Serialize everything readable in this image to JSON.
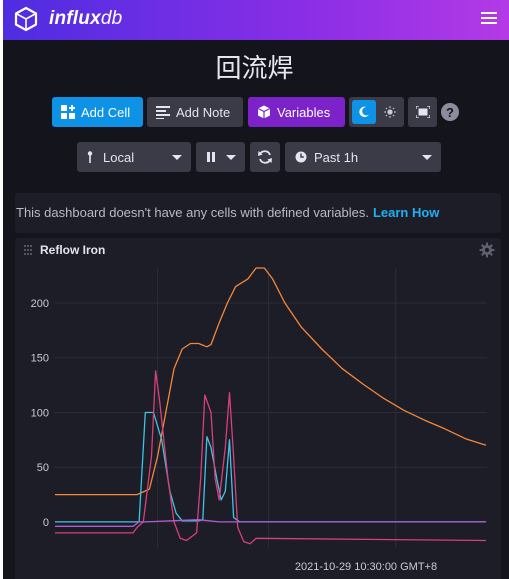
{
  "app": {
    "logo_text_bold": "influx",
    "logo_text_light": "db"
  },
  "dashboard": {
    "title": "回流焊"
  },
  "toolbar": {
    "add_cell_label": "Add Cell",
    "add_note_label": "Add Note",
    "variables_label": "Variables",
    "help_label": "?"
  },
  "controls": {
    "timezone": "Local",
    "time_range": "Past 1h"
  },
  "notice": {
    "text": "This dashboard doesn't have any cells with defined variables.",
    "link_label": "Learn How"
  },
  "cell": {
    "title": "Reflow Iron"
  },
  "colors": {
    "accent": "#0d92e6",
    "variables": "#7b22c8",
    "link": "#1fb0f2"
  },
  "chart_data": {
    "type": "line",
    "y_ticks": [
      "200",
      "150",
      "100",
      "50",
      "0"
    ],
    "y_tick_values": [
      200,
      150,
      100,
      50,
      0
    ],
    "ylim": [
      -22,
      232
    ],
    "x_tick_label": "2021-10-29 10:30:00 GMT+8",
    "grid": true,
    "legend": "none",
    "series": [
      {
        "color": "#f5873a",
        "points": [
          [
            0,
            25
          ],
          [
            0.2,
            25
          ],
          [
            0.23,
            30
          ],
          [
            0.25,
            60
          ],
          [
            0.27,
            100
          ],
          [
            0.29,
            140
          ],
          [
            0.31,
            158
          ],
          [
            0.33,
            163
          ],
          [
            0.35,
            163
          ],
          [
            0.37,
            160
          ],
          [
            0.38,
            162
          ],
          [
            0.4,
            182
          ],
          [
            0.42,
            200
          ],
          [
            0.44,
            215
          ],
          [
            0.47,
            222
          ],
          [
            0.49,
            232
          ],
          [
            0.51,
            232
          ],
          [
            0.53,
            222
          ],
          [
            0.56,
            200
          ],
          [
            0.6,
            178
          ],
          [
            0.65,
            158
          ],
          [
            0.7,
            140
          ],
          [
            0.75,
            126
          ],
          [
            0.8,
            113
          ],
          [
            0.85,
            102
          ],
          [
            0.9,
            93
          ],
          [
            0.95,
            85
          ],
          [
            1.0,
            76
          ],
          [
            1.05,
            70
          ]
        ]
      },
      {
        "color": "#3fc3e6",
        "points": [
          [
            0,
            0
          ],
          [
            0.19,
            0
          ],
          [
            0.205,
            0
          ],
          [
            0.22,
            100
          ],
          [
            0.24,
            100
          ],
          [
            0.26,
            75
          ],
          [
            0.28,
            28
          ],
          [
            0.295,
            8
          ],
          [
            0.31,
            1
          ],
          [
            0.35,
            1
          ],
          [
            0.36,
            2
          ],
          [
            0.37,
            78
          ],
          [
            0.38,
            68
          ],
          [
            0.395,
            38
          ],
          [
            0.405,
            20
          ],
          [
            0.415,
            28
          ],
          [
            0.425,
            75
          ],
          [
            0.435,
            4
          ],
          [
            0.45,
            0
          ],
          [
            1.05,
            0
          ]
        ]
      },
      {
        "color": "#d7417a",
        "points": [
          [
            0,
            -10
          ],
          [
            0.19,
            -10
          ],
          [
            0.2,
            -5
          ],
          [
            0.215,
            0
          ],
          [
            0.235,
            60
          ],
          [
            0.245,
            138
          ],
          [
            0.255,
            110
          ],
          [
            0.275,
            40
          ],
          [
            0.29,
            0
          ],
          [
            0.305,
            -15
          ],
          [
            0.32,
            -17
          ],
          [
            0.345,
            -10
          ],
          [
            0.355,
            40
          ],
          [
            0.365,
            116
          ],
          [
            0.38,
            100
          ],
          [
            0.39,
            40
          ],
          [
            0.4,
            20
          ],
          [
            0.415,
            68
          ],
          [
            0.425,
            118
          ],
          [
            0.435,
            60
          ],
          [
            0.445,
            -5
          ],
          [
            0.46,
            -18
          ],
          [
            0.475,
            -20
          ],
          [
            0.49,
            -15
          ],
          [
            1.05,
            -17
          ]
        ]
      },
      {
        "color": "#b05cd6",
        "points": [
          [
            0,
            -4
          ],
          [
            0.19,
            -4
          ],
          [
            0.205,
            0
          ],
          [
            0.22,
            0
          ],
          [
            0.35,
            2
          ],
          [
            0.4,
            0
          ],
          [
            1.05,
            0
          ]
        ]
      }
    ]
  }
}
